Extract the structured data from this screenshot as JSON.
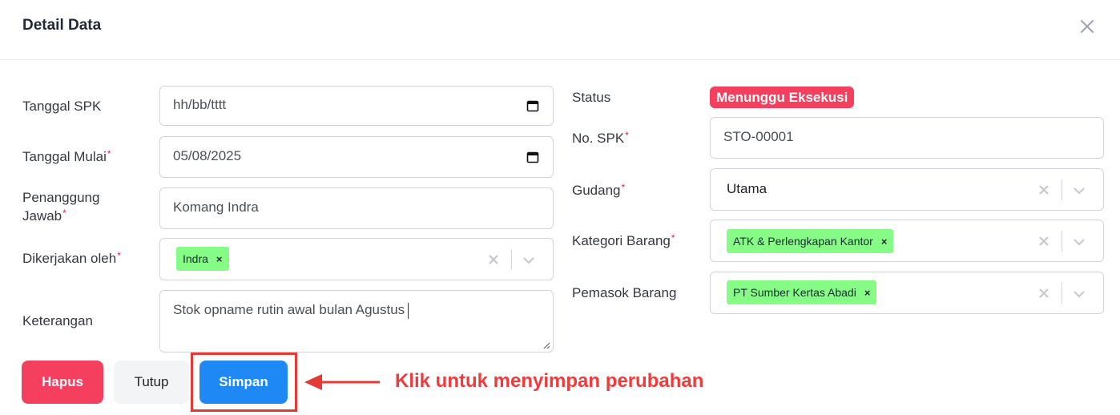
{
  "modal": {
    "title": "Detail Data"
  },
  "left": {
    "tanggal_spk": {
      "label": "Tanggal SPK",
      "value": "hh/bb/tttt"
    },
    "tanggal_mulai": {
      "label": "Tanggal Mulai",
      "value": "05/08/2025",
      "required": "*"
    },
    "penanggung": {
      "label_line1": "Penanggung",
      "label_line2": "Jawab",
      "value": "Komang Indra",
      "required": "*"
    },
    "dikerjakan": {
      "label": "Dikerjakan oleh",
      "tag": "Indra",
      "required": "*"
    },
    "keterangan": {
      "label": "Keterangan",
      "value": "Stok opname rutin awal bulan Agustus"
    }
  },
  "right": {
    "status": {
      "label": "Status",
      "badge": "Menunggu Eksekusi"
    },
    "no_spk": {
      "label": "No. SPK",
      "value": "STO-00001",
      "required": "*"
    },
    "gudang": {
      "label": "Gudang",
      "value": "Utama",
      "required": "*"
    },
    "kategori": {
      "label": "Kategori Barang",
      "tag": "ATK & Perlengkapan Kantor",
      "required": "*"
    },
    "pemasok": {
      "label": "Pemasok Barang",
      "tag": "PT Sumber Kertas Abadi"
    }
  },
  "buttons": {
    "hapus": "Hapus",
    "tutup": "Tutup",
    "simpan": "Simpan"
  },
  "annotation": "Klik untuk menyimpan perubahan",
  "tag_remove": "×",
  "colors": {
    "danger": "#f43f5e",
    "primary": "#1e88f5",
    "tag": "#86fb86",
    "annotation": "#ef3b3b"
  }
}
